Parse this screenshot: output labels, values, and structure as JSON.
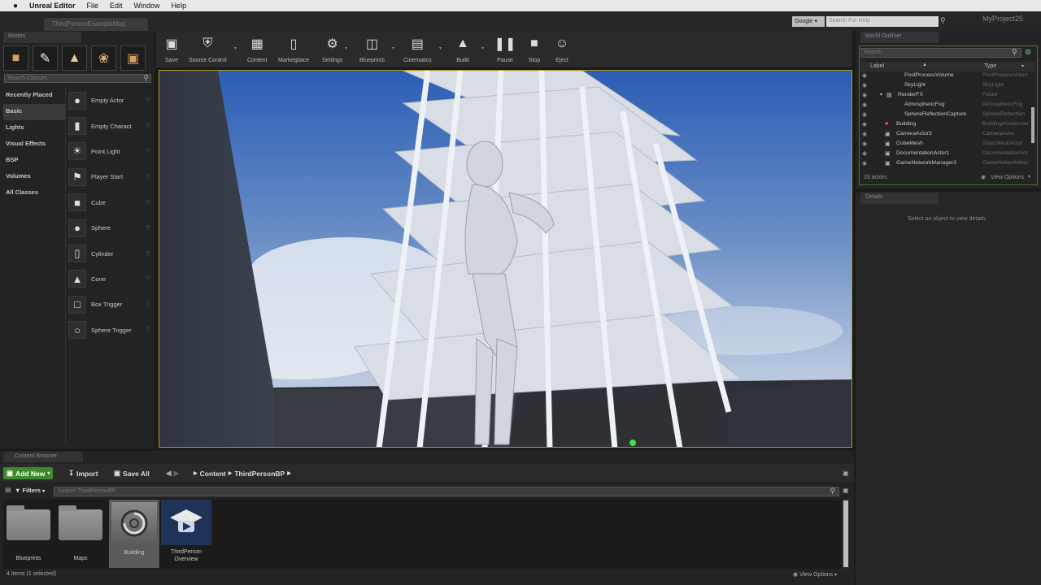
{
  "menubar": {
    "app_name": "Unreal Editor",
    "items": [
      "File",
      "Edit",
      "Window",
      "Help"
    ]
  },
  "window": {
    "level_tab": "ThirdPersonExampleMap",
    "search_engine": "Google",
    "search_placeholder": "Search For Help",
    "project_name": "MyProject25"
  },
  "modes": {
    "tab_label": "Modes",
    "search_placeholder": "Search Classes",
    "mode_icons": [
      "place-mode-icon",
      "paint-mode-icon",
      "landscape-mode-icon",
      "foliage-mode-icon",
      "geometry-mode-icon"
    ],
    "categories": [
      "Recently Placed",
      "Basic",
      "Lights",
      "Visual Effects",
      "BSP",
      "Volumes",
      "All Classes"
    ],
    "selected_category": "Basic",
    "items": [
      {
        "label": "Empty Actor",
        "icon": "sphere-icon"
      },
      {
        "label": "Empty Charact",
        "icon": "character-icon"
      },
      {
        "label": "Point Light",
        "icon": "light-bulb-icon"
      },
      {
        "label": "Player Start",
        "icon": "player-start-icon"
      },
      {
        "label": "Cube",
        "icon": "cube-icon"
      },
      {
        "label": "Sphere",
        "icon": "sphere-icon"
      },
      {
        "label": "Cylinder",
        "icon": "cylinder-icon"
      },
      {
        "label": "Cone",
        "icon": "cone-icon"
      },
      {
        "label": "Box Trigger",
        "icon": "box-trigger-icon"
      },
      {
        "label": "Sphere Trigger",
        "icon": "sphere-trigger-icon"
      }
    ]
  },
  "toolbar": {
    "buttons": [
      "Save",
      "Source Control",
      "Content",
      "Marketplace",
      "Settings",
      "Blueprints",
      "Cinematics",
      "Build",
      "Pause",
      "Stop",
      "Eject"
    ]
  },
  "outliner": {
    "tab_label": "World Outliner",
    "search_placeholder": "Search...",
    "col_label": "Label",
    "col_type": "Type",
    "rows": [
      {
        "name": "PostProcessVolume",
        "type": "PostProcessVolume",
        "indent": 2
      },
      {
        "name": "SkyLight",
        "type": "SkyLight",
        "indent": 2
      },
      {
        "name": "RenderFX",
        "type": "Folder",
        "indent": 1
      },
      {
        "name": "AtmosphericFog",
        "type": "AtmosphericFog",
        "indent": 2
      },
      {
        "name": "SphereReflectionCapture",
        "type": "SphereReflection",
        "indent": 2
      },
      {
        "name": "Building",
        "type": "BuildingAssetActor",
        "indent": 1
      },
      {
        "name": "CameraActor3",
        "type": "CameraActor",
        "indent": 1
      },
      {
        "name": "CubeMesh",
        "type": "StaticMeshActor",
        "indent": 1
      },
      {
        "name": "DocumentationActor1",
        "type": "DocumentationActor",
        "indent": 1
      },
      {
        "name": "GameNetworkManager3",
        "type": "GameNetworkManager",
        "indent": 1
      }
    ],
    "actor_count": "33 actors",
    "view_options": "View Options"
  },
  "details": {
    "tab_label": "Details",
    "message": "Select an object to view details."
  },
  "content_browser": {
    "tab_label": "Content Browser",
    "add_new": "Add New",
    "import": "Import",
    "save_all": "Save All",
    "path": [
      "Content",
      "ThirdPersonBP"
    ],
    "filters": "Filters",
    "search_placeholder": "Search ThirdPersonBP",
    "assets": [
      {
        "name": "Blueprints",
        "kind": "folder"
      },
      {
        "name": "Maps",
        "kind": "folder"
      },
      {
        "name": "Building",
        "kind": "asset-selected"
      },
      {
        "name": "ThirdPerson Overview",
        "kind": "tutorial"
      }
    ],
    "status": "4 items (1 selected)",
    "view_options": "View Options"
  },
  "colors": {
    "add_new": "#3d8a2a",
    "viewport_border": "#b09a20",
    "outliner_border": "#4a7a2a"
  }
}
